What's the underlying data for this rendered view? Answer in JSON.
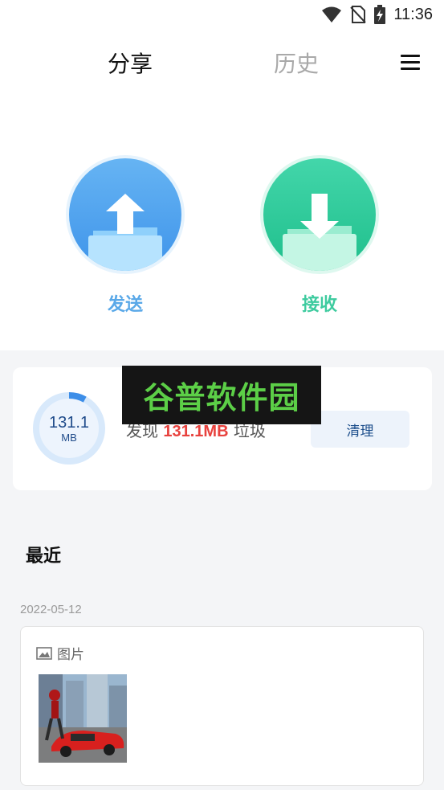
{
  "status_bar": {
    "time": "11:36",
    "icons": [
      "wifi-icon",
      "no-sim-icon",
      "battery-charging-icon"
    ]
  },
  "tabs": [
    {
      "label": "分享",
      "active": true
    },
    {
      "label": "历史",
      "active": false
    }
  ],
  "menu_icon": "hamburger-menu-icon",
  "actions": {
    "send": {
      "label": "发送",
      "color": "#59a8e8",
      "icon": "upload-folder-icon"
    },
    "receive": {
      "label": "接收",
      "color": "#3ecb9f",
      "icon": "download-folder-icon"
    }
  },
  "junk": {
    "ring_value": "131.1",
    "ring_unit": "MB",
    "prefix": "发现",
    "amount": "131.1MB",
    "suffix": "垃圾",
    "clean_label": "清理",
    "progress_fraction": 0.08,
    "accent": "#e8423e"
  },
  "watermark": "谷普软件园",
  "recent": {
    "title": "最近",
    "groups": [
      {
        "date": "2022-05-12",
        "category": "图片",
        "category_icon": "image-icon",
        "items": [
          "image-thumbnail"
        ]
      }
    ]
  }
}
